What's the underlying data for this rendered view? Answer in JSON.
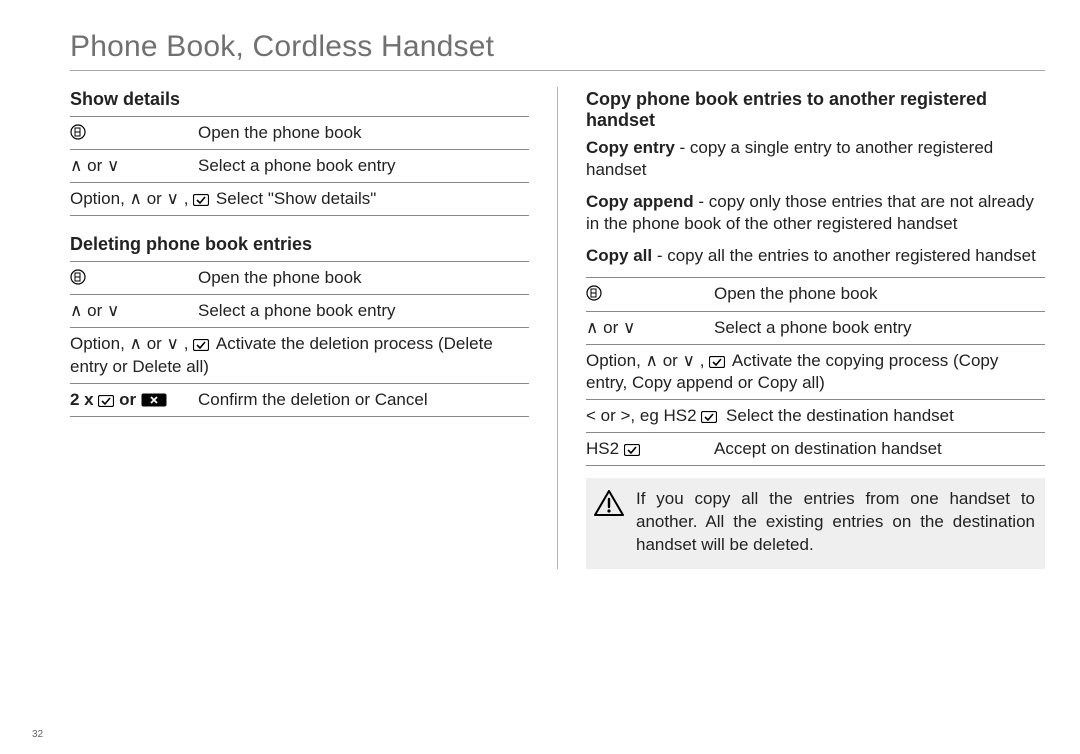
{
  "title": "Phone Book, Cordless Handset",
  "page_number": "32",
  "glyphs": {
    "up": "∧",
    "down": "∨",
    "lt": "<",
    "gt": ">",
    "or": "or",
    "comma": ","
  },
  "left": {
    "section1": {
      "heading": "Show details",
      "rows": {
        "r1_k_icon": "phonebook",
        "r1_v": "Open the phone book",
        "r2_k": "∧ or ∨",
        "r2_v": "Select a phone book entry",
        "r3_k": "Option, ∧ or ∨ ,",
        "r3_kicon": "check",
        "r3_v": "Select \"Show details\""
      }
    },
    "section2": {
      "heading": "Deleting phone book entries",
      "rows": {
        "r1_k_icon": "phonebook",
        "r1_v": "Open the phone book",
        "r2_k": "∧ or ∨",
        "r2_v": "Select a phone book entry",
        "r3_k": "Option, ∧ or ∨ ,",
        "r3_kicon": "check",
        "r3_v": "Activate the deletion process (Delete entry or Delete all)",
        "r4_k_prefix": "2 x",
        "r4_k_or": "or",
        "r4_v": "Confirm the deletion or Cancel"
      }
    }
  },
  "right": {
    "heading": "Copy phone book entries to another registered handset",
    "defs": {
      "d1_b": "Copy entry",
      "d1_t": " - copy a single entry to another registered handset",
      "d2_b": "Copy append",
      "d2_t": " - copy only those entries that are not already in the phone book of the other registered handset",
      "d3_b": "Copy all",
      "d3_t": " - copy all the entries to another registered handset"
    },
    "rows": {
      "r1_v": "Open the phone book",
      "r2_k": "∧ or ∨",
      "r2_v": "Select a phone book entry",
      "r3_k": "Option, ∧ or ∨ ,",
      "r3_v": "Activate the copying process (Copy entry, Copy append or Copy all)",
      "r4_k": "< or >, eg HS2",
      "r4_v": "Select the destination handset",
      "r5_k": "HS2",
      "r5_v": "Accept on destination handset"
    },
    "note": "If you copy all the entries from one handset to another. All the existing entries on the destination handset will be deleted."
  }
}
